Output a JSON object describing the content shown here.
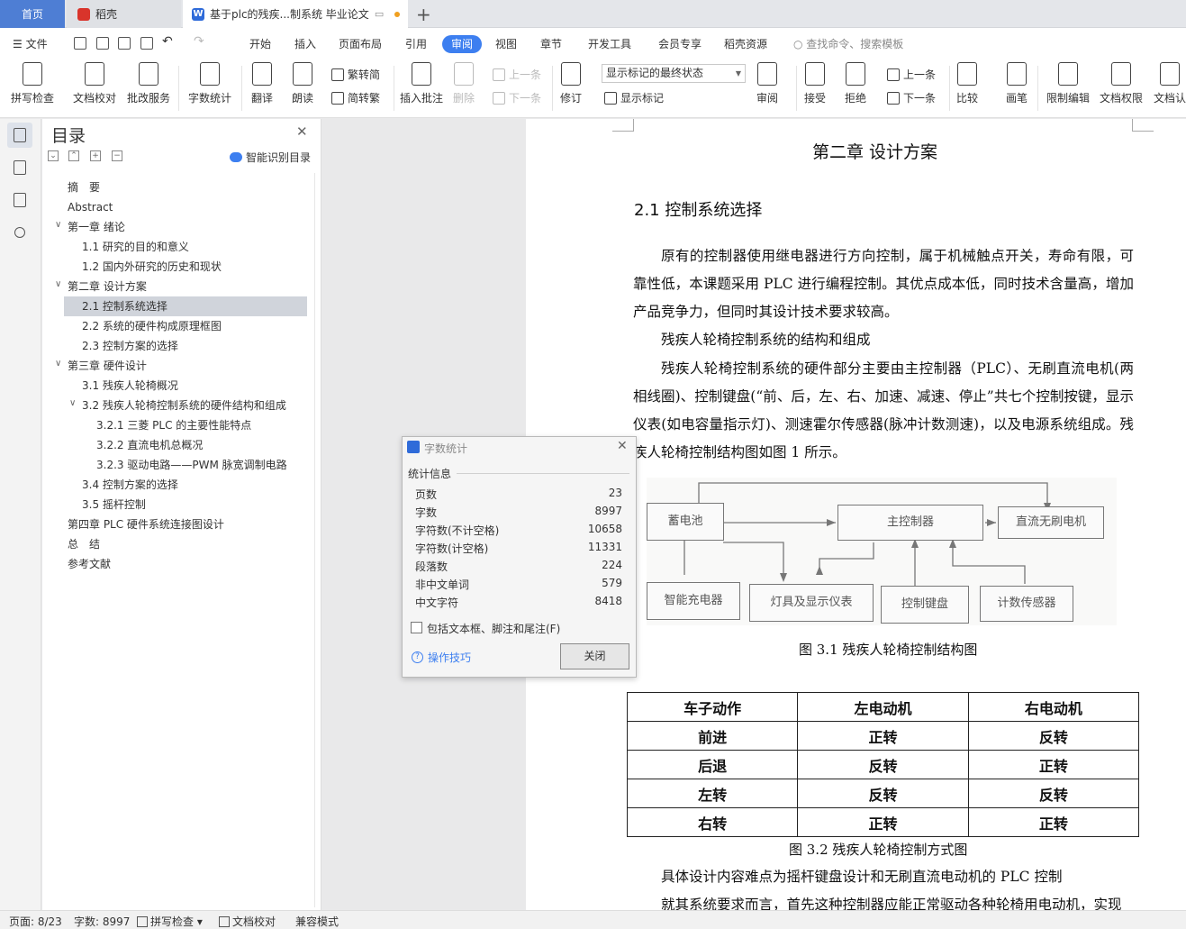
{
  "tabs": {
    "home": "首页",
    "daoke": "稻壳",
    "doc": "基于plc的残疾...制系统 毕业论文",
    "doc_logo": "W"
  },
  "menubar": {
    "file": "文件",
    "items": [
      "开始",
      "插入",
      "页面布局",
      "引用",
      "审阅",
      "视图",
      "章节",
      "开发工具",
      "会员专享",
      "稻壳资源"
    ],
    "active": "审阅",
    "search": "查找命令、搜索模板"
  },
  "ribbon": {
    "spellcheck": "拼写检查",
    "doc_proof": "文档校对",
    "batch_revise": "批改服务",
    "word_count": "字数统计",
    "translate": "翻译",
    "read_aloud": "朗读",
    "trad_to_simp": "繁转简",
    "simp_to_trad": "简转繁",
    "insert_comment": "插入批注",
    "delete": "删除",
    "prev": "上一条",
    "next": "下一条",
    "track_changes": "修订",
    "markup_state": "显示标记的最终状态",
    "show_markup": "显示标记",
    "review": "审阅",
    "accept": "接受",
    "reject": "拒绝",
    "prev2": "上一条",
    "next2": "下一条",
    "compare": "比较",
    "draw": "画笔",
    "restrict_edit": "限制编辑",
    "doc_permission": "文档权限",
    "doc_cert": "文档认"
  },
  "toc": {
    "title": "目录",
    "smart": "智能识别目录",
    "items": [
      {
        "label": "摘　要"
      },
      {
        "label": "Abstract"
      },
      {
        "label": "第一章  绪论"
      },
      {
        "label": "1.1 研究的目的和意义"
      },
      {
        "label": "1.2 国内外研究的历史和现状"
      },
      {
        "label": "第二章  设计方案"
      },
      {
        "label": "2.1 控制系统选择"
      },
      {
        "label": "2.2  系统的硬件构成原理框图"
      },
      {
        "label": "2.3  控制方案的选择"
      },
      {
        "label": "第三章  硬件设计"
      },
      {
        "label": "3.1 残疾人轮椅概况"
      },
      {
        "label": "3.2 残疾人轮椅控制系统的硬件结构和组成"
      },
      {
        "label": "3.2.1  三菱 PLC 的主要性能特点"
      },
      {
        "label": "3.2.2 直流电机总概况"
      },
      {
        "label": "3.2.3  驱动电路——PWM 脉宽调制电路"
      },
      {
        "label": "3.4 控制方案的选择"
      },
      {
        "label": "3.5 摇杆控制"
      },
      {
        "label": "第四章  PLC 硬件系统连接图设计"
      },
      {
        "label": "总　结"
      },
      {
        "label": "参考文献"
      }
    ]
  },
  "document": {
    "chapter_title": "第二章  设计方案",
    "section_title": "2.1 控制系统选择",
    "para1": "原有的控制器使用继电器进行方向控制，属于机械触点开关，寿命有限，可靠性低，本课题采用 PLC 进行编程控制。其优点成本低，同时技术含量高，增加产品竞争力，但同时其设计技术要求较高。",
    "para2": "残疾人轮椅控制系统的结构和组成",
    "para3": "残疾人轮椅控制系统的硬件部分主要由主控制器（PLC）、无刷直流电机(两相线圈)、控制键盘(“前、后，左、右、加速、减速、停止”共七个控制按键，显示仪表(如电容量指示灯)、测速霍尔传感器(脉冲计数测速)，以及电源系统组成。残疾人轮椅控制结构图如图 1 所示。",
    "diagram": {
      "battery": "蓄电池",
      "main_controller": "主控制器",
      "dc_motor": "直流无刷电机",
      "charger": "智能充电器",
      "lamps": "灯具及显示仪表",
      "keyboard": "控制键盘",
      "counter_sensor": "计数传感器"
    },
    "fig1_caption": "图 3.1  残疾人轮椅控制结构图",
    "table": {
      "headers": [
        "车子动作",
        "左电动机",
        "右电动机"
      ],
      "rows": [
        [
          "前进",
          "正转",
          "反转"
        ],
        [
          "后退",
          "反转",
          "正转"
        ],
        [
          "左转",
          "反转",
          "反转"
        ],
        [
          "右转",
          "正转",
          "正转"
        ]
      ]
    },
    "fig2_caption": "图 3.2  残疾人轮椅控制方式图",
    "para4": "具体设计内容难点为摇杆键盘设计和无刷直流电动机的 PLC 控制",
    "para5": "就其系统要求而言，首先这种控制器应能正常驱动各种轮椅用电动机，实现"
  },
  "word_count_dialog": {
    "title": "字数统计",
    "section": "统计信息",
    "rows": [
      {
        "label": "页数",
        "value": "23"
      },
      {
        "label": "字数",
        "value": "8997"
      },
      {
        "label": "字符数(不计空格)",
        "value": "10658"
      },
      {
        "label": "字符数(计空格)",
        "value": "11331"
      },
      {
        "label": "段落数",
        "value": "224"
      },
      {
        "label": "非中文单词",
        "value": "579"
      },
      {
        "label": "中文字符",
        "value": "8418"
      }
    ],
    "include_label": "包括文本框、脚注和尾注(F)",
    "include_checked": false,
    "tips": "操作技巧",
    "close": "关闭"
  },
  "statusbar": {
    "page": "页面: 8/23",
    "words": "字数: 8997",
    "spellcheck": "拼写检查",
    "proof": "文档校对",
    "compat": "兼容模式"
  }
}
